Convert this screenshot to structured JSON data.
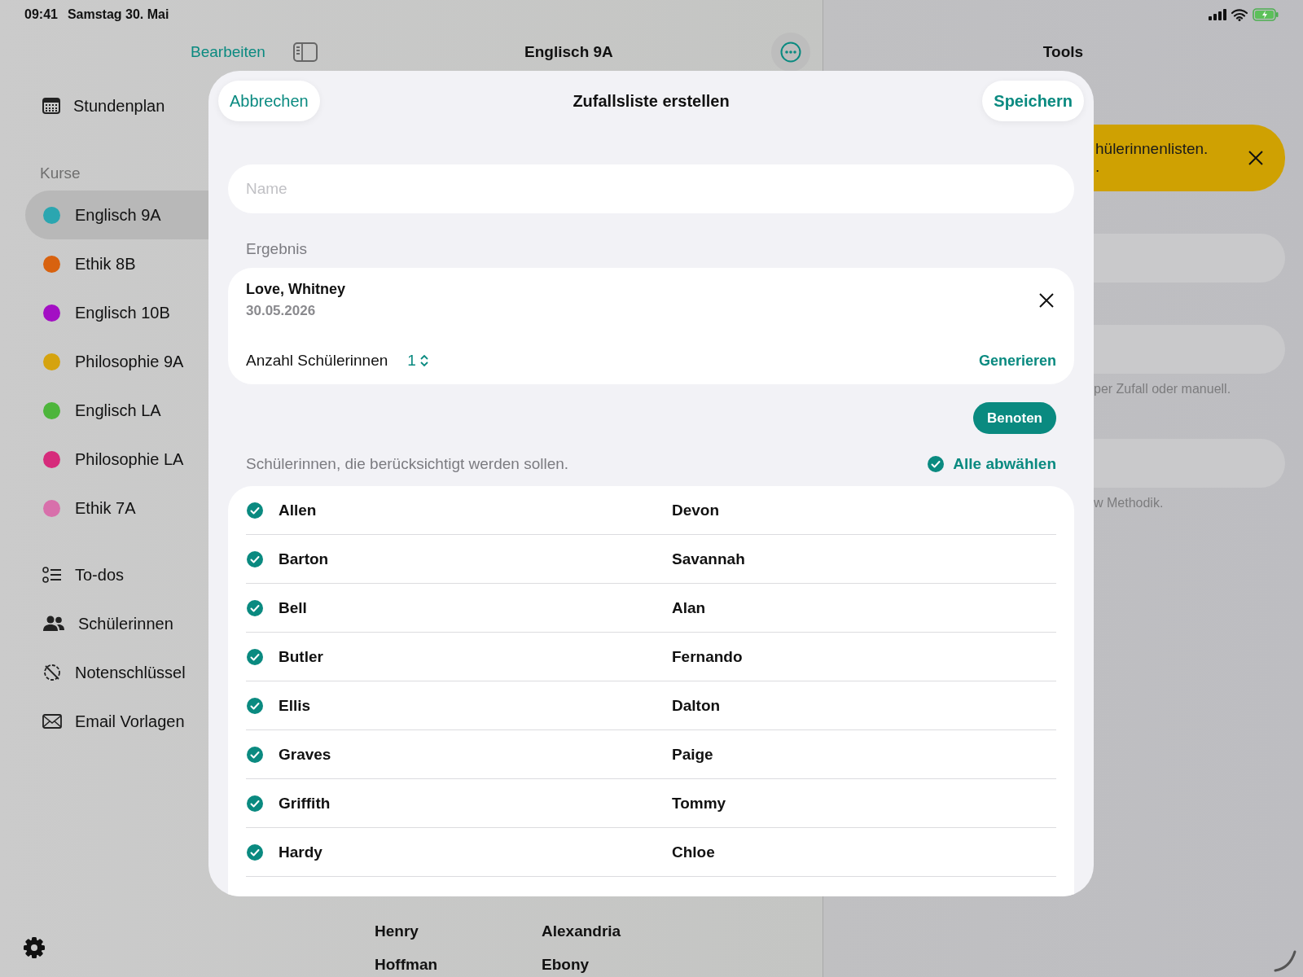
{
  "status_bar": {
    "time": "09:41",
    "date": "Samstag 30. Mai"
  },
  "nav": {
    "edit": "Bearbeiten",
    "title": "Englisch 9A"
  },
  "sidebar": {
    "top_items": [
      {
        "label": "Stundenplan",
        "kind": "calendar"
      }
    ],
    "section_title": "Kurse",
    "courses": [
      {
        "label": "Englisch 9A",
        "color": "#2ba6b0",
        "selected": true
      },
      {
        "label": "Ethik 8B",
        "color": "#d8620f",
        "selected": false
      },
      {
        "label": "Englisch 10B",
        "color": "#a30fc4",
        "selected": false
      },
      {
        "label": "Philosophie 9A",
        "color": "#d5a30f",
        "selected": false
      },
      {
        "label": "Englisch LA",
        "color": "#4db53b",
        "selected": false
      },
      {
        "label": "Philosophie LA",
        "color": "#d62b7b",
        "selected": false
      },
      {
        "label": "Ethik 7A",
        "color": "#d870ab",
        "selected": false
      }
    ],
    "tools": [
      {
        "label": "To-dos",
        "kind": "todo"
      },
      {
        "label": "Schülerinnen",
        "kind": "people"
      },
      {
        "label": "Notenschlüssel",
        "kind": "grade"
      },
      {
        "label": "Email Vorlagen",
        "kind": "mail"
      }
    ]
  },
  "main": {
    "rows": [
      {
        "last": "Henry",
        "first": "Alexandria"
      },
      {
        "last": "Hoffman",
        "first": "Ebony"
      }
    ]
  },
  "right_panel": {
    "title": "Tools",
    "banner": {
      "lines": [
        "hülerinnenlisten.",
        "."
      ]
    },
    "cards": [
      {
        "kind": "row"
      },
      {
        "kind": "row",
        "caption": "per Zufall oder manuell."
      },
      {
        "kind": "row",
        "caption": "w Methodik."
      }
    ]
  },
  "dialog": {
    "cancel": "Abbrechen",
    "title": "Zufallsliste erstellen",
    "save": "Speichern",
    "name_field": {
      "placeholder": "Name"
    },
    "result_label": "Ergebnis",
    "result": {
      "name": "Love, Whitney",
      "date": "30.05.2026",
      "count_label": "Anzahl Schülerinnen",
      "count": "1",
      "generate": "Generieren"
    },
    "grade_button": "Benoten",
    "hint": "Schülerinnen, die berücksichtigt werden sollen.",
    "deselect_all": "Alle abwählen",
    "students": [
      {
        "last": "Allen",
        "first": "Devon",
        "selected": true
      },
      {
        "last": "Barton",
        "first": "Savannah",
        "selected": true
      },
      {
        "last": "Bell",
        "first": "Alan",
        "selected": true
      },
      {
        "last": "Butler",
        "first": "Fernando",
        "selected": true
      },
      {
        "last": "Ellis",
        "first": "Dalton",
        "selected": true
      },
      {
        "last": "Graves",
        "first": "Paige",
        "selected": true
      },
      {
        "last": "Griffith",
        "first": "Tommy",
        "selected": true
      },
      {
        "last": "Hardy",
        "first": "Chloe",
        "selected": true
      }
    ]
  }
}
